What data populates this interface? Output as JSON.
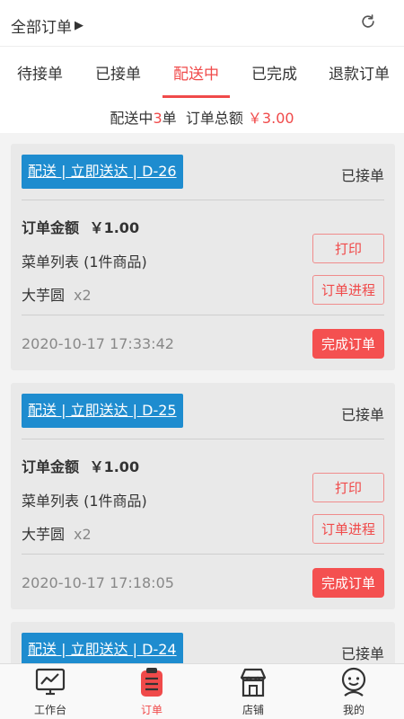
{
  "header": {
    "filter_label": "全部订单",
    "filter_arrow": "▶",
    "refresh_icon": "refresh-icon"
  },
  "tabs": [
    {
      "label": "待接单",
      "active": false
    },
    {
      "label": "已接单",
      "active": false
    },
    {
      "label": "配送中",
      "active": true
    },
    {
      "label": "已完成",
      "active": false
    },
    {
      "label": "退款订单",
      "active": false
    }
  ],
  "summary": {
    "prefix": "配送中",
    "count": "3",
    "count_unit": "单",
    "total_label": "订单总额",
    "total_value": "￥3.00"
  },
  "orders": [
    {
      "badge": "配送 | 立即送达 | D-26",
      "status": "已接单",
      "amount_label": "订单金额",
      "amount": "￥1.00",
      "menu_label": "菜单列表 (1件商品)",
      "item_name": "大芋圆",
      "item_qty": "x2",
      "print_label": "打印",
      "progress_label": "订单进程",
      "time": "2020-10-17 17:33:42",
      "complete_label": "完成订单"
    },
    {
      "badge": "配送 | 立即送达 | D-25",
      "status": "已接单",
      "amount_label": "订单金额",
      "amount": "￥1.00",
      "menu_label": "菜单列表 (1件商品)",
      "item_name": "大芋圆",
      "item_qty": "x2",
      "print_label": "打印",
      "progress_label": "订单进程",
      "time": "2020-10-17 17:18:05",
      "complete_label": "完成订单"
    },
    {
      "badge": "配送 | 立即送达 | D-24",
      "status": "已接单"
    }
  ],
  "bottom_nav": [
    {
      "label": "工作台",
      "icon": "dashboard-chart-icon",
      "active": false
    },
    {
      "label": "订单",
      "icon": "order-clipboard-icon",
      "active": true
    },
    {
      "label": "店铺",
      "icon": "store-icon",
      "active": false
    },
    {
      "label": "我的",
      "icon": "user-profile-icon",
      "active": false
    }
  ],
  "colors": {
    "accent": "#f04a4a",
    "badge_blue": "#1e8ccf",
    "card_bg": "#e9e9e9",
    "list_bg": "#f3f3f3"
  }
}
